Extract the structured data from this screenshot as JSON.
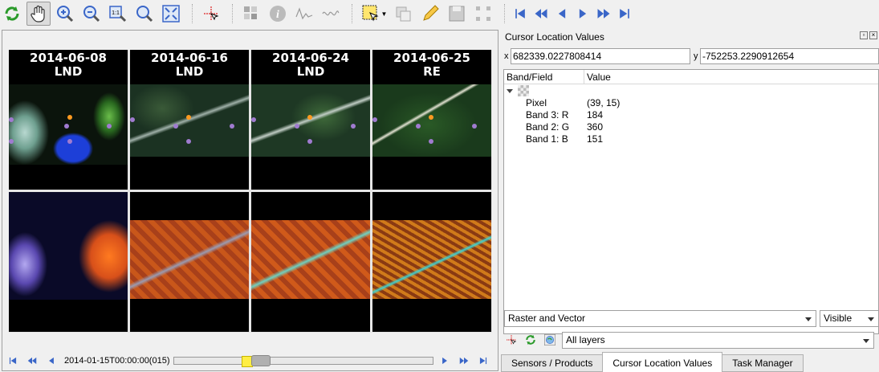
{
  "toolbar": {
    "tools": [
      "refresh-icon",
      "pan-hand-icon",
      "zoom-in-icon",
      "zoom-out-icon",
      "zoom-native-icon",
      "zoom-magnifier-icon",
      "zoom-full-icon",
      "cursor-location-icon",
      "spectral-tool-icon",
      "info-icon",
      "spectral-profile-icon",
      "temporal-profile-icon",
      "select-icon",
      "layer-properties-icon",
      "edit-pencil-icon",
      "save-edits-icon",
      "node-tool-icon",
      "first-icon",
      "previous-fast-icon",
      "previous-icon",
      "next-icon",
      "next-fast-icon",
      "last-icon"
    ],
    "hand_active": true,
    "buttons": {
      "zoom_native_label": "1:1"
    }
  },
  "view": {
    "dates": [
      {
        "date": "2014-06-08",
        "sensor": "LND"
      },
      {
        "date": "2014-06-16",
        "sensor": "LND"
      },
      {
        "date": "2014-06-24",
        "sensor": "LND"
      },
      {
        "date": "2014-06-25",
        "sensor": "RE"
      }
    ]
  },
  "timebar": {
    "timestamp": "2014-01-15T00:00:00(015)",
    "slider_position": 0.3
  },
  "dock": {
    "title": "Cursor Location Values",
    "x_label": "x",
    "x_value": "682339.0227808414",
    "y_label": "y",
    "y_value": "-752253.2290912654",
    "columns": [
      "Band/Field",
      "Value"
    ],
    "rows": [
      {
        "key": "Pixel",
        "value": "(39, 15)"
      },
      {
        "key": "Band 3: R",
        "value": "184"
      },
      {
        "key": "Band 2: G",
        "value": "360"
      },
      {
        "key": "Band 1: B",
        "value": "151"
      }
    ],
    "mode_select": "Raster and Vector",
    "visibility_select": "Visible",
    "layers_select": "All layers",
    "tabs": [
      "Sensors / Products",
      "Cursor Location Values",
      "Task Manager"
    ],
    "selected_tab": "Cursor Location Values"
  },
  "colors": {
    "accent": "#3a66c8",
    "marker_purple": "#a07bd0",
    "marker_orange": "#ff9a20"
  }
}
